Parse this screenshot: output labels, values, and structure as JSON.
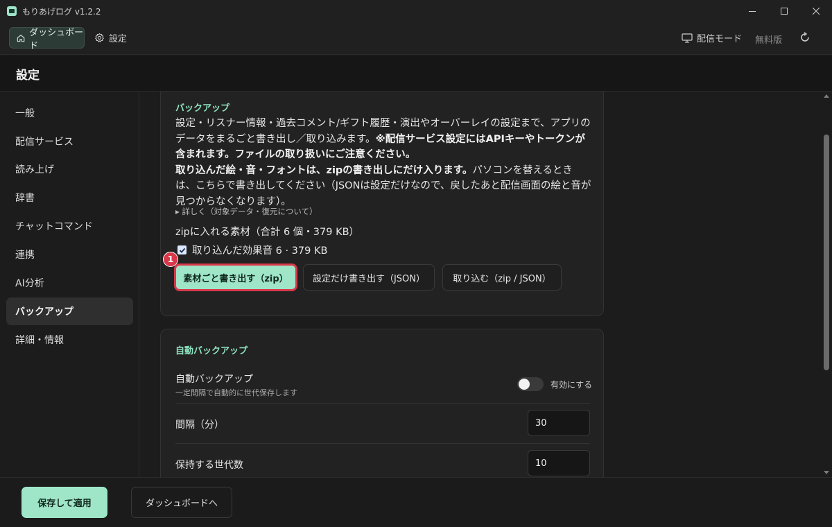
{
  "window": {
    "title": "もりあげログ v1.2.2",
    "controls": [
      "minimize-icon",
      "maximize-icon",
      "close-icon"
    ]
  },
  "toolbar": {
    "dashboard_label": "ダッシュボード",
    "settings_label": "設定",
    "broadcast_mode_label": "配信モード",
    "free_label": "無料版"
  },
  "page": {
    "title": "設定"
  },
  "sidebar": {
    "items": [
      {
        "label": "一般"
      },
      {
        "label": "配信サービス"
      },
      {
        "label": "読み上げ"
      },
      {
        "label": "辞書"
      },
      {
        "label": "チャットコマンド"
      },
      {
        "label": "連携"
      },
      {
        "label": "AI分析"
      },
      {
        "label": "バックアップ",
        "active": true
      },
      {
        "label": "詳細・情報"
      }
    ]
  },
  "backup": {
    "section_title": "バックアップ",
    "desc_part1": "設定・リスナー情報・過去コメント/ギフト履歴・演出やオーバーレイの設定まで、アプリのデータをまるごと書き出し／取り込みます。",
    "desc_bold1": "※配信サービス設定にはAPIキーやトークンが含まれます。ファイルの取り扱いにご注意ください。",
    "desc_bold2": "取り込んだ絵・音・フォントは、zipの書き出しにだけ入ります。",
    "desc_part2": "パソコンを替えるときは、こちらで書き出してください（JSONは設定だけなので、戻したあと配信画面の絵と音が見つからなくなります）。",
    "details_link": "詳しく（対象データ・復元について）",
    "zip_heading": "zipに入れる素材（合計 6 個・379 KB）",
    "checkbox_label": "取り込んだ効果音 6 · 379 KB",
    "checkbox_checked": true,
    "btn_zip": "素材ごと書き出す（zip）",
    "btn_json": "設定だけ書き出す（JSON）",
    "btn_import": "取り込む（zip / JSON）",
    "badge_number": "1"
  },
  "auto_backup": {
    "section_title": "自動バックアップ",
    "toggle_title": "自動バックアップ",
    "toggle_sub": "一定間隔で自動的に世代保存します",
    "toggle_label": "有効にする",
    "toggle_on": false,
    "interval_label": "間隔（分）",
    "interval_value": "30",
    "generations_label": "保持する世代数",
    "generations_value": "10"
  },
  "footer": {
    "save_label": "保存して適用",
    "dashboard_label": "ダッシュボードへ"
  },
  "colors": {
    "accent": "#9fe6c9",
    "highlight_red": "#d8384a",
    "background": "#1c1c1c"
  }
}
